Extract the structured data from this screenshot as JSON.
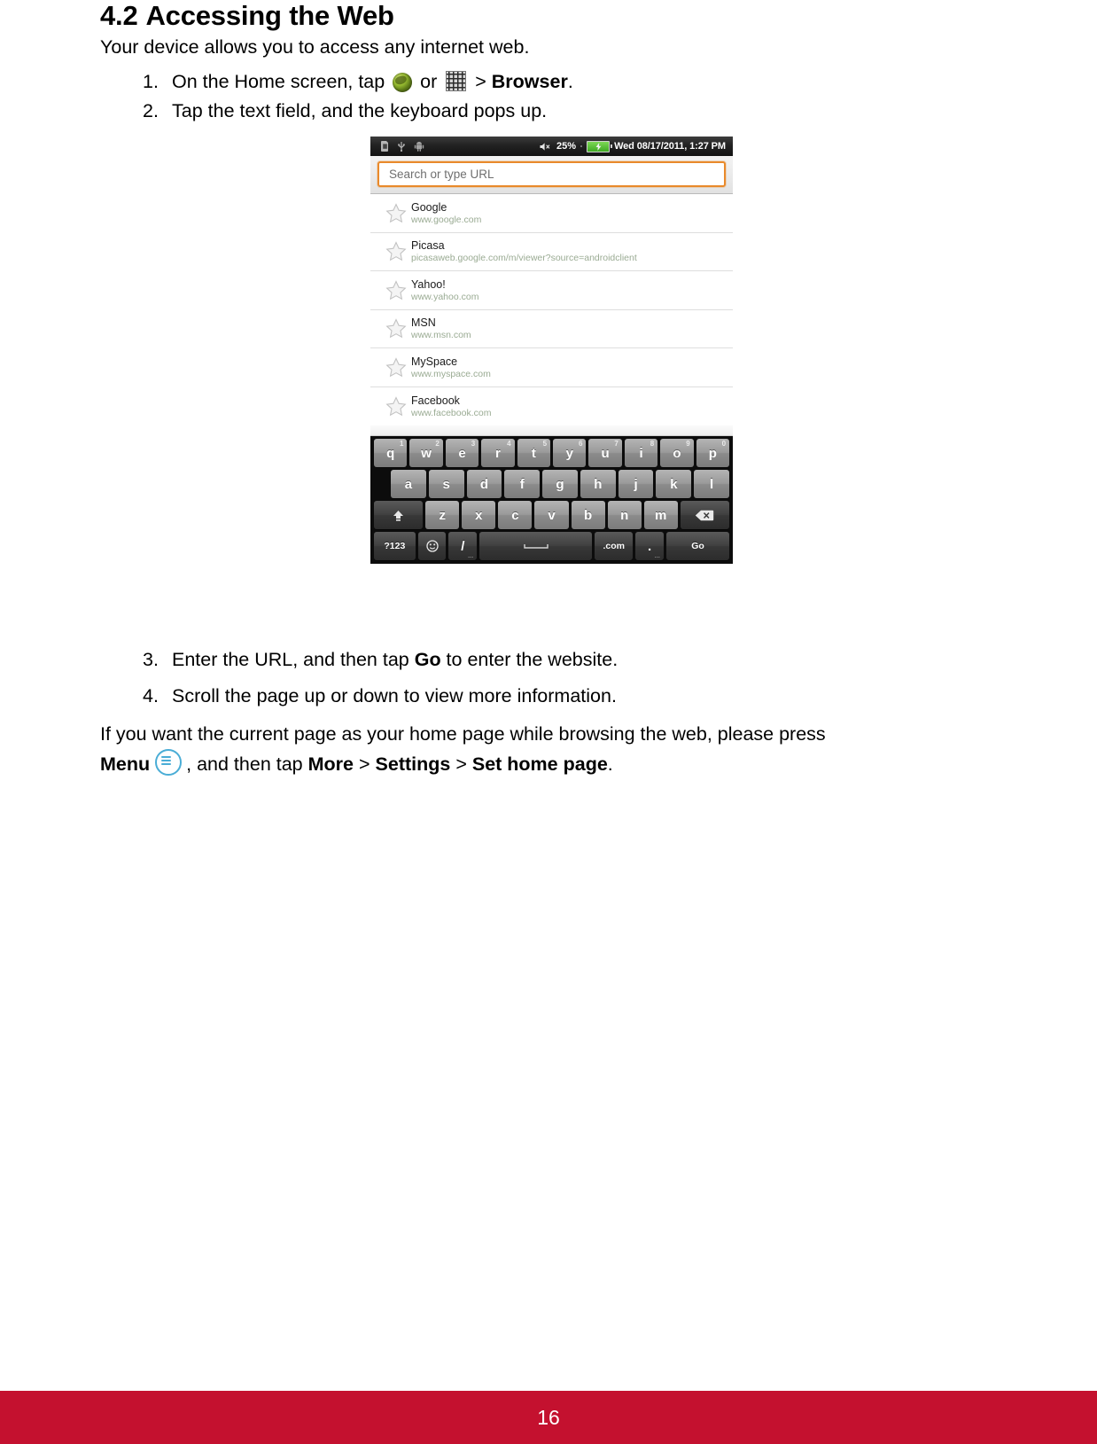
{
  "document": {
    "section_number": "4.2",
    "section_title": "Accessing the Web",
    "intro": "Your device allows you to access any internet web.",
    "steps": [
      {
        "num": "1.",
        "pre": "On the Home screen, tap ",
        "mid": " or ",
        "post": " > ",
        "bold": "Browser",
        "end": "."
      },
      {
        "num": "2.",
        "text": "Tap the text field, and the keyboard pops up."
      },
      {
        "num": "3.",
        "pre": "Enter the URL, and then tap ",
        "bold": "Go",
        "post": " to enter the website."
      },
      {
        "num": "4.",
        "text": "Scroll the page up or down to view more information."
      }
    ],
    "closing_line_1": "If you want the current page as your home page while browsing the web, please press",
    "closing_menu_label": "Menu",
    "closing_mid": ", and then tap ",
    "closing_more": "More",
    "closing_sep1": " > ",
    "closing_settings": "Settings",
    "closing_sep2": " > ",
    "closing_sethome": "Set home page",
    "closing_end": "."
  },
  "footer": {
    "page_number": "16",
    "bar_color": "#c4112f"
  },
  "device": {
    "statusbar": {
      "icons": [
        "sdcard-icon",
        "usb-icon",
        "android-robot-icon"
      ],
      "mute_icon": "volume-mute-icon",
      "battery_percent": "25%",
      "battery_state": "charging",
      "datetime": "Wed 08/17/2011, 1:27 PM"
    },
    "urlbar": {
      "placeholder": "Search or type URL",
      "value": "",
      "focus_color": "#e98a2b"
    },
    "bookmarks": [
      {
        "title": "Google",
        "url": "www.google.com"
      },
      {
        "title": "Picasa",
        "url": "picasaweb.google.com/m/viewer?source=androidclient"
      },
      {
        "title": "Yahoo!",
        "url": "www.yahoo.com"
      },
      {
        "title": "MSN",
        "url": "www.msn.com"
      },
      {
        "title": "MySpace",
        "url": "www.myspace.com"
      },
      {
        "title": "Facebook",
        "url": "www.facebook.com"
      }
    ],
    "keyboard": {
      "row1": [
        {
          "k": "q",
          "sup": "1"
        },
        {
          "k": "w",
          "sup": "2"
        },
        {
          "k": "e",
          "sup": "3"
        },
        {
          "k": "r",
          "sup": "4"
        },
        {
          "k": "t",
          "sup": "5"
        },
        {
          "k": "y",
          "sup": "6"
        },
        {
          "k": "u",
          "sup": "7"
        },
        {
          "k": "i",
          "sup": "8"
        },
        {
          "k": "o",
          "sup": "9"
        },
        {
          "k": "p",
          "sup": "0"
        }
      ],
      "row2": [
        {
          "k": "a"
        },
        {
          "k": "s"
        },
        {
          "k": "d"
        },
        {
          "k": "f"
        },
        {
          "k": "g"
        },
        {
          "k": "h"
        },
        {
          "k": "j"
        },
        {
          "k": "k"
        },
        {
          "k": "l"
        }
      ],
      "row3": [
        {
          "k": "z"
        },
        {
          "k": "x"
        },
        {
          "k": "c"
        },
        {
          "k": "v"
        },
        {
          "k": "b"
        },
        {
          "k": "n"
        },
        {
          "k": "m"
        }
      ],
      "shift_label": "",
      "delete_label": "",
      "row4": {
        "numbers_label": "?123",
        "emoji_label": "",
        "slash_label": "/",
        "slash_sub": "...",
        "space_label": "",
        "com_label": ".com",
        "dot_label": ".",
        "dot_sub": "...",
        "go_label": "Go"
      }
    }
  }
}
